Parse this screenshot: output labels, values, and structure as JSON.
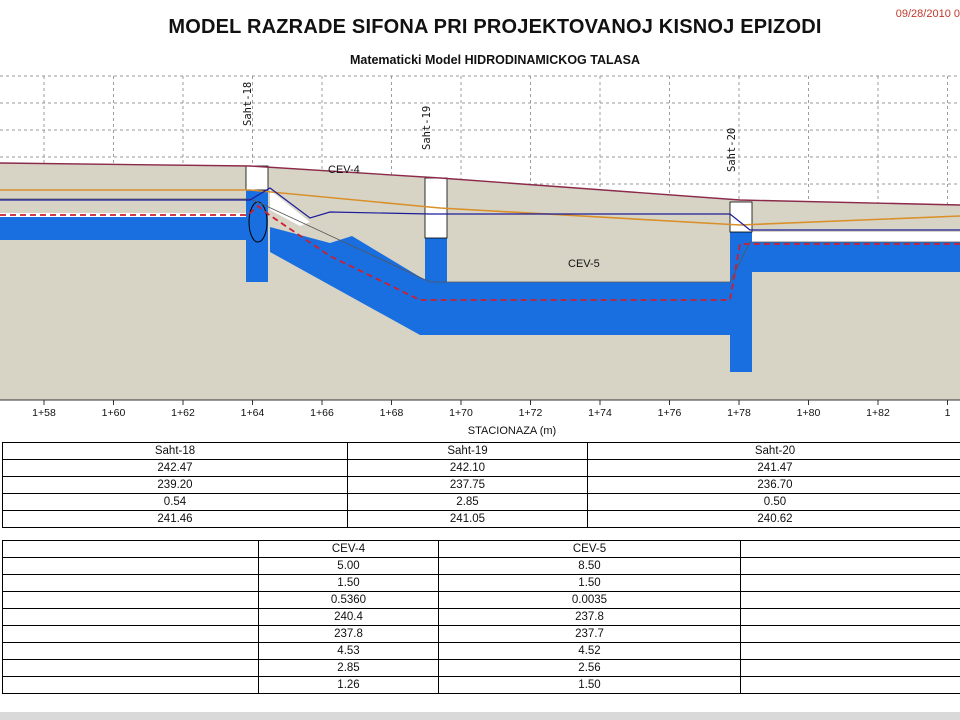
{
  "header": {
    "title": "MODEL RAZRADE SIFONA PRI PROJEKTOVANOJ KISNOJ EPIZODI",
    "subtitle": "Matematicki Model HIDRODINAMICKOG TALASA",
    "date": "09/28/2010 0"
  },
  "profile": {
    "x_axis_title": "STACIONAZA (m)",
    "x_ticks": [
      "1+58",
      "1+60",
      "1+62",
      "1+64",
      "1+66",
      "1+68",
      "1+70",
      "1+72",
      "1+74",
      "1+76",
      "1+78",
      "1+80",
      "1+82",
      "1"
    ],
    "shaft_labels": [
      "Saht-18",
      "Saht-19",
      "Saht-20"
    ],
    "pipe_labels": [
      "CEV-4",
      "CEV-5"
    ],
    "colors": {
      "ground": "#d7d4c6",
      "water": "#1a6fe0",
      "terrain_line": "#8b2a4a",
      "pipe_crown": "#d9902a",
      "hgl_dashed": "#cc1f2f",
      "energy_line": "#1c1c9a",
      "grid": "#777777"
    }
  },
  "shaft_table": {
    "headers": [
      "Saht-18",
      "Saht-19",
      "Saht-20"
    ],
    "rows": [
      [
        "242.47",
        "242.10",
        "241.47"
      ],
      [
        "239.20",
        "237.75",
        "236.70"
      ],
      [
        "0.54",
        "2.85",
        "0.50"
      ],
      [
        "241.46",
        "241.05",
        "240.62"
      ]
    ]
  },
  "pipe_table": {
    "headers": [
      "CEV-4",
      "CEV-5"
    ],
    "rows": [
      [
        "5.00",
        "8.50"
      ],
      [
        "1.50",
        "1.50"
      ],
      [
        "0.5360",
        "0.0035"
      ],
      [
        "240.4",
        "237.8"
      ],
      [
        "237.8",
        "237.7"
      ],
      [
        "4.53",
        "4.52"
      ],
      [
        "2.85",
        "2.56"
      ],
      [
        "1.26",
        "1.50"
      ]
    ]
  }
}
